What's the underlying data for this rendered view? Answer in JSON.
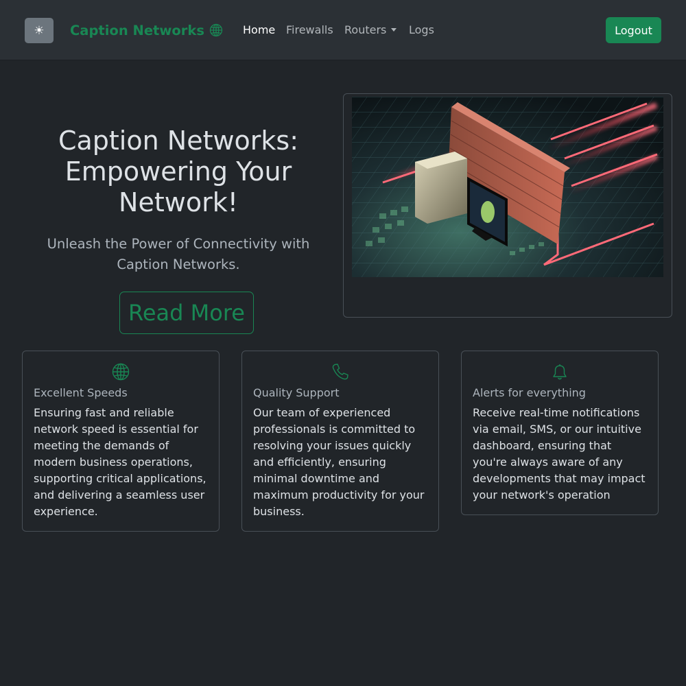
{
  "navbar": {
    "theme_toggle_icon": "☀",
    "brand": "Caption Networks",
    "links": [
      {
        "label": "Home",
        "active": true
      },
      {
        "label": "Firewalls"
      },
      {
        "label": "Routers",
        "dropdown": true
      },
      {
        "label": "Logs"
      }
    ],
    "logout_label": "Logout"
  },
  "hero": {
    "title": "Caption Networks: Empowering Your Network!",
    "subtitle": "Unleash the Power of Connectivity with Caption Networks.",
    "button_label": "Read More"
  },
  "features": [
    {
      "icon": "globe-icon",
      "title": "Excellent Speeds",
      "text": "Ensuring fast and reliable network speed is essential for meeting the demands of modern business operations, supporting critical applications, and delivering a seamless user experience."
    },
    {
      "icon": "phone-icon",
      "title": "Quality Support",
      "text": "Our team of experienced professionals is committed to resolving your issues quickly and efficiently, ensuring minimal downtime and maximum productivity for your business."
    },
    {
      "icon": "bell-icon",
      "title": "Alerts for everything",
      "text": "Receive real-time notifications via email, SMS, or our intuitive dashboard, ensuring that you're always aware of any developments that may impact your network's operation"
    }
  ],
  "colors": {
    "background": "#212529",
    "navbar": "#2b3035",
    "accent": "#198754",
    "border": "#495057"
  }
}
